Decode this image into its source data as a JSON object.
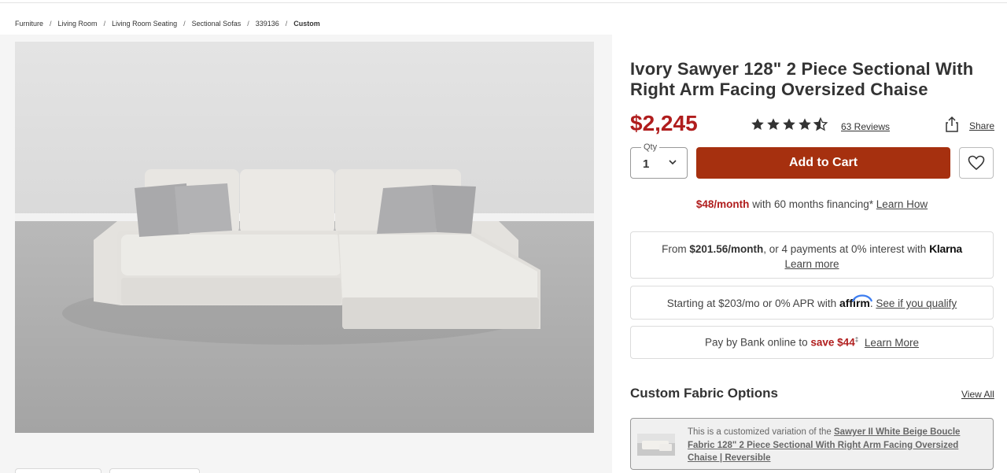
{
  "breadcrumb": {
    "items": [
      "Furniture",
      "Living Room",
      "Living Room Seating",
      "Sectional Sofas",
      "339136"
    ],
    "current": "Custom",
    "separator": "/"
  },
  "product": {
    "title": "Ivory Sawyer 128\" 2 Piece Sectional With Right Arm Facing Oversized Chaise",
    "price": "$2,245",
    "rating": 4.5,
    "rating_max": 5,
    "reviews_label": "63 Reviews",
    "share_label": "Share"
  },
  "purchase": {
    "qty_label": "Qty",
    "qty_value": "1",
    "add_to_cart_label": "Add to Cart"
  },
  "financing": {
    "monthly": "$48/month",
    "text": "with 60 months financing*",
    "learn_how": "Learn How"
  },
  "klarna": {
    "prefix": "From",
    "amount": "$201.56/month",
    "middle": ", or 4 payments at 0% interest with",
    "logo": "Klarna",
    "learn_more": "Learn more"
  },
  "affirm": {
    "text": "Starting at $203/mo or 0% APR with",
    "logo": "affirm",
    "period": ".",
    "link": "See if you qualify"
  },
  "bank": {
    "text": "Pay by Bank online to",
    "save": "save $44",
    "save_mark": "‡",
    "learn_more": "Learn More"
  },
  "fabric": {
    "heading": "Custom Fabric Options",
    "view_all": "View All",
    "variation_prefix": "This is a customized variation of the",
    "variation_link": "Sawyer II White Beige Boucle Fabric 128\" 2 Piece Sectional With Right Arm Facing Oversized Chaise | Reversible"
  },
  "colors": {
    "price_red": "#b01d1d",
    "cart_button": "#a6300f",
    "star": "#333333"
  },
  "icons": [
    "star-icon",
    "share-icon",
    "chevron-down-icon",
    "heart-icon"
  ]
}
